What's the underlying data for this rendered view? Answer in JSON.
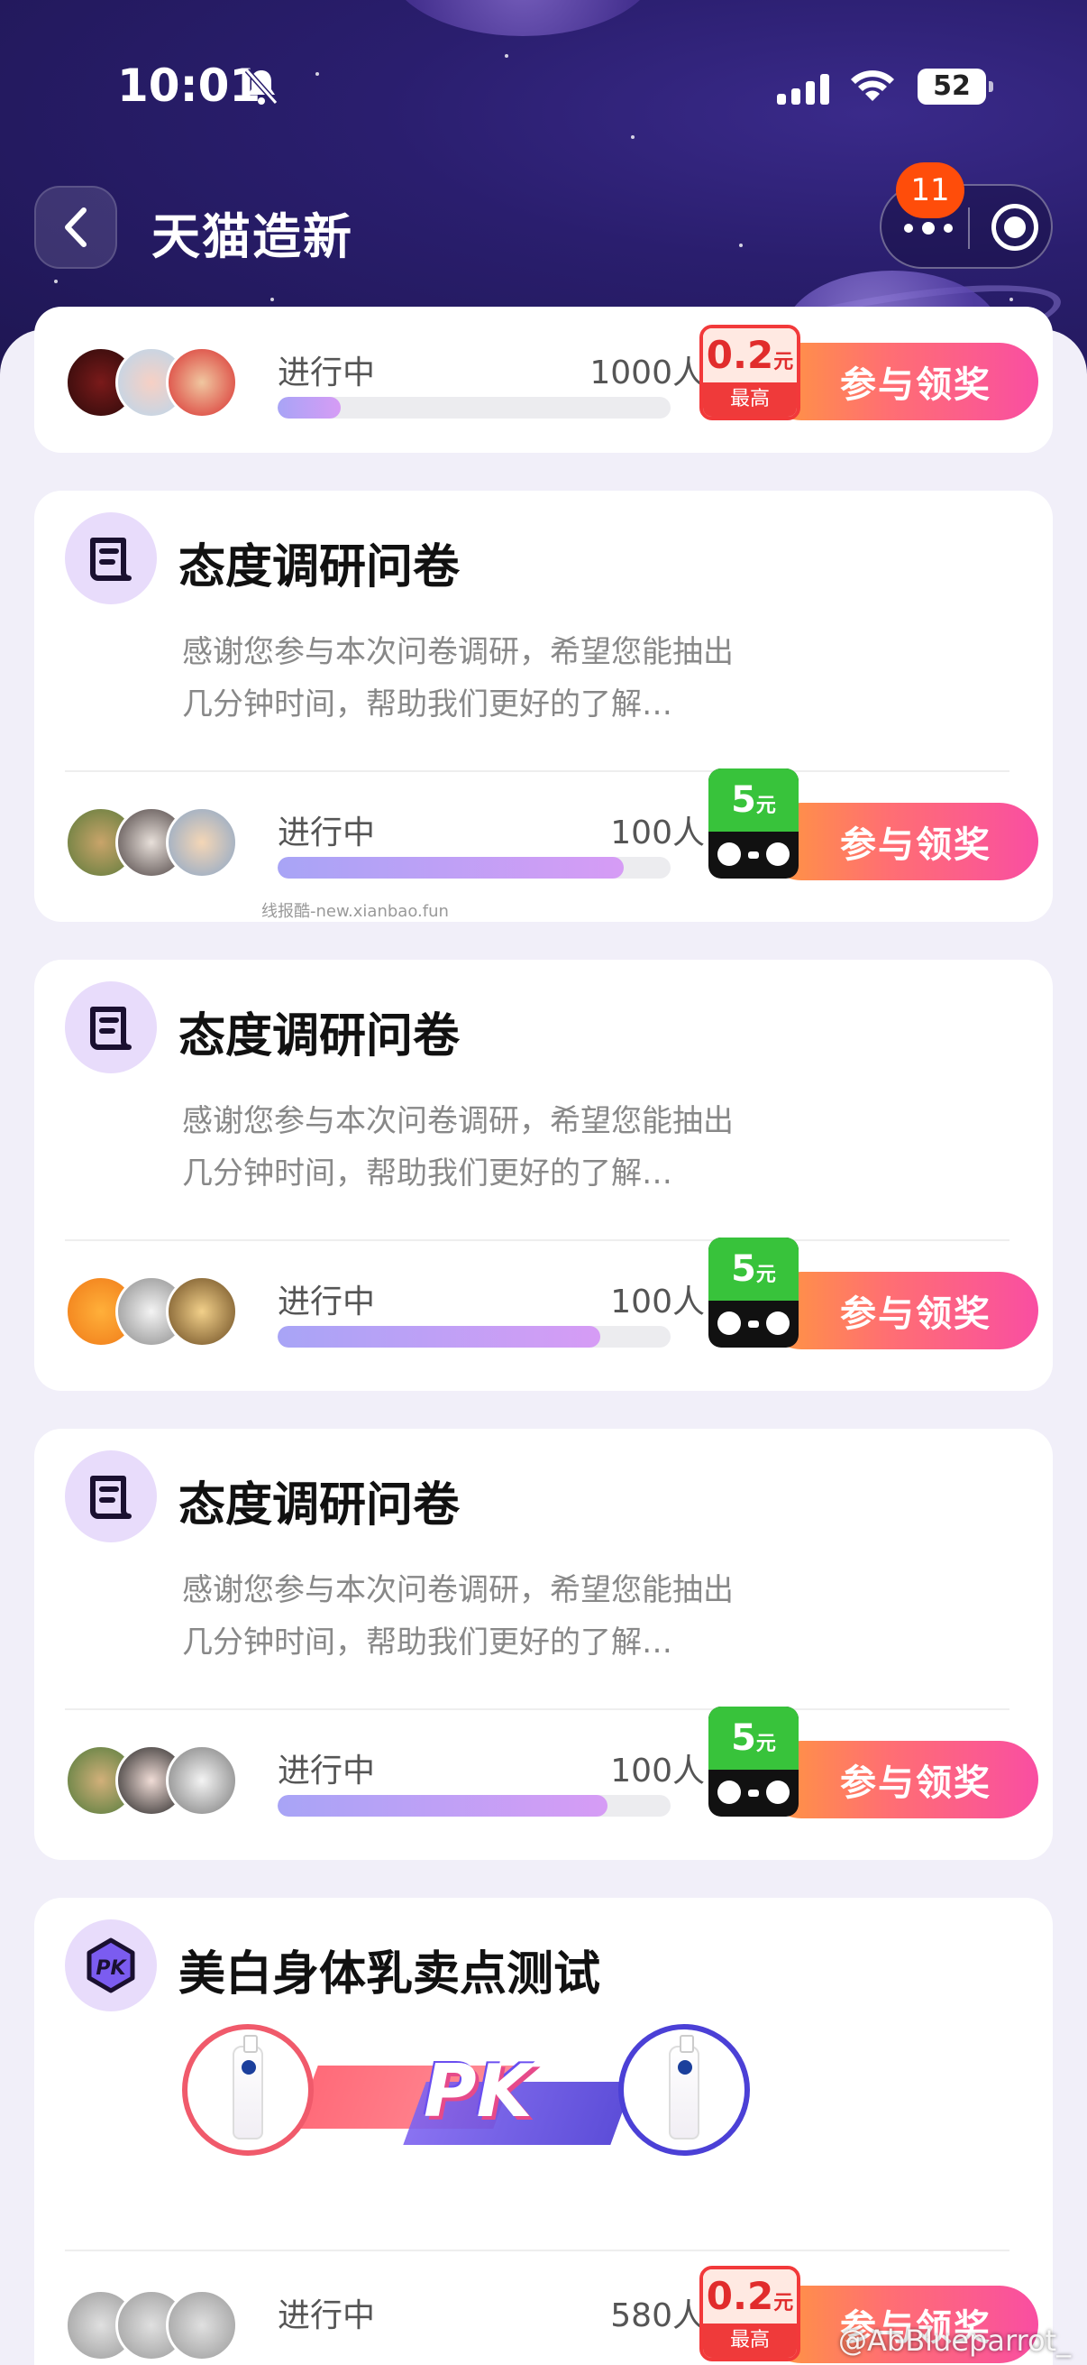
{
  "status_bar": {
    "time": "10:01",
    "battery": "52"
  },
  "nav": {
    "title": "天猫造新",
    "notification_count": "11"
  },
  "colors": {
    "accent_gradient_start": "#ff9a3c",
    "accent_gradient_end": "#f94ea2",
    "progress_start": "#a8a4f6",
    "progress_end": "#d69cf5",
    "reward_green": "#38c33b",
    "reward_red": "#f2393a"
  },
  "cards": [
    {
      "status": "进行中",
      "count": "1000人",
      "progress": 0.16,
      "reward_amount": "0.2",
      "reward_unit": "元",
      "reward_note": "最高",
      "button": "参与领奖"
    },
    {
      "icon": "scroll-icon",
      "title": "态度调研问卷",
      "desc": "感谢您参与本次问卷调研，希望您能抽出几分钟时间，帮助我们更好的了解…",
      "status": "进行中",
      "count": "100人",
      "progress": 0.88,
      "reward_amount": "5",
      "reward_unit": "元",
      "button": "参与领奖",
      "watermark": "线报酷-new.xianbao.fun"
    },
    {
      "icon": "scroll-icon",
      "title": "态度调研问卷",
      "desc": "感谢您参与本次问卷调研，希望您能抽出几分钟时间，帮助我们更好的了解…",
      "status": "进行中",
      "count": "100人",
      "progress": 0.82,
      "reward_amount": "5",
      "reward_unit": "元",
      "button": "参与领奖"
    },
    {
      "icon": "scroll-icon",
      "title": "态度调研问卷",
      "desc": "感谢您参与本次问卷调研，希望您能抽出几分钟时间，帮助我们更好的了解…",
      "status": "进行中",
      "count": "100人",
      "progress": 0.84,
      "reward_amount": "5",
      "reward_unit": "元",
      "button": "参与领奖"
    },
    {
      "icon": "pk-icon",
      "title": "美白身体乳卖点测试",
      "pk_text": "PK",
      "status": "进行中",
      "count": "580人",
      "reward_amount": "0.2",
      "reward_unit": "元",
      "reward_note": "最高",
      "button": "参与领奖"
    }
  ],
  "corner_watermark": "@AbBlueparrot_"
}
